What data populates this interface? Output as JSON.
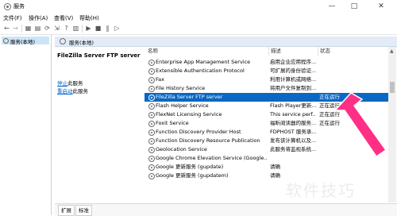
{
  "window": {
    "title": "服务",
    "minimize_label": "—",
    "maximize_label": "□",
    "close_label": "✕"
  },
  "menu": {
    "items": [
      "文件(F)",
      "操作(A)",
      "查看(V)",
      "帮助(H)"
    ]
  },
  "tree": {
    "items": [
      {
        "label": "服务(本地)"
      }
    ]
  },
  "content_header": {
    "label": "服务(本地)"
  },
  "details": {
    "service_name": "FileZilla Server FTP server",
    "actions": [
      {
        "prefix": "停止",
        "suffix": "此服务"
      },
      {
        "prefix": "重启动",
        "suffix": "此服务"
      }
    ]
  },
  "table": {
    "columns": [
      "名称",
      "描述",
      "状态"
    ],
    "rows": [
      {
        "name": "Enterprise App Management Service",
        "desc": "启用企业应用程序...",
        "status": ""
      },
      {
        "name": "Extensible Authentication Protocol",
        "desc": "可扩展的身份验证...",
        "status": ""
      },
      {
        "name": "Fax",
        "desc": "利用计算机或网络...",
        "status": ""
      },
      {
        "name": "File History Service",
        "desc": "将用户文件复制到...",
        "status": ""
      },
      {
        "name": "FileZilla Server FTP server",
        "desc": "",
        "status": "正在运行",
        "selected": true
      },
      {
        "name": "Flash Helper Service",
        "desc": "Flash Player更新...",
        "status": "正在运行"
      },
      {
        "name": "FlexNet Licensing Service",
        "desc": "This service perf...",
        "status": "正在运行"
      },
      {
        "name": "Foxit Service",
        "desc": "福昕阅读器的服务...",
        "status": "正在运行"
      },
      {
        "name": "Function Discovery Provider Host",
        "desc": "FDPHOST 服务承...",
        "status": ""
      },
      {
        "name": "Function Discovery Resource Publication",
        "desc": "发布该计算机以及...",
        "status": ""
      },
      {
        "name": "Geolocation Service",
        "desc": "此服务将监视系统...",
        "status": ""
      },
      {
        "name": "Google Chrome Elevation Service (Google...",
        "desc": "",
        "status": ""
      },
      {
        "name": "Google 更新服务 (gupdate)",
        "desc": "请确",
        "status": ""
      },
      {
        "name": "Google 更新服务 (gupdatem)",
        "desc": "请确",
        "status": ""
      }
    ]
  },
  "tabs": [
    "扩展",
    "标准"
  ],
  "watermark": "软件技巧",
  "colors": {
    "selection": "#0a67c3",
    "link": "#0066cc",
    "arrow": "#ff2f86"
  }
}
